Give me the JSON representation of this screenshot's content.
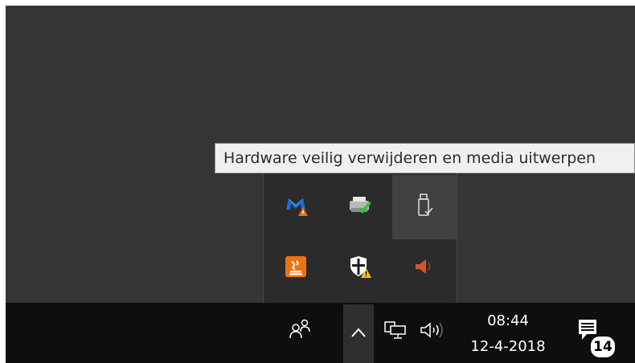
{
  "tooltip": {
    "text": "Hardware veilig verwijderen en media uitwerpen"
  },
  "tray_overflow": {
    "icons": [
      {
        "name": "malwarebytes-icon",
        "row": 1,
        "col": 1
      },
      {
        "name": "printer-ok-icon",
        "row": 1,
        "col": 2
      },
      {
        "name": "usb-eject-icon",
        "row": 1,
        "col": 3,
        "hovered": true
      },
      {
        "name": "java-update-icon",
        "row": 2,
        "col": 1
      },
      {
        "name": "security-warning-shield-icon",
        "row": 2,
        "col": 2
      },
      {
        "name": "volume-muted-orange-icon",
        "row": 2,
        "col": 3
      }
    ]
  },
  "taskbar": {
    "people_icon": "people-icon",
    "show_hidden_icon": "chevron-up-icon",
    "network_icon": "network-wired-icon",
    "volume_icon": "speaker-icon",
    "clock": {
      "time": "08:44",
      "date": "12-4-2018"
    },
    "notifications": {
      "icon": "action-center-icon",
      "count": "14"
    }
  },
  "colors": {
    "desktop": "#353535",
    "taskbar": "#0e0e0e",
    "panel": "#2b2b2b",
    "tooltip_bg": "#f0f0f0",
    "accent_orange": "#f0720f"
  }
}
